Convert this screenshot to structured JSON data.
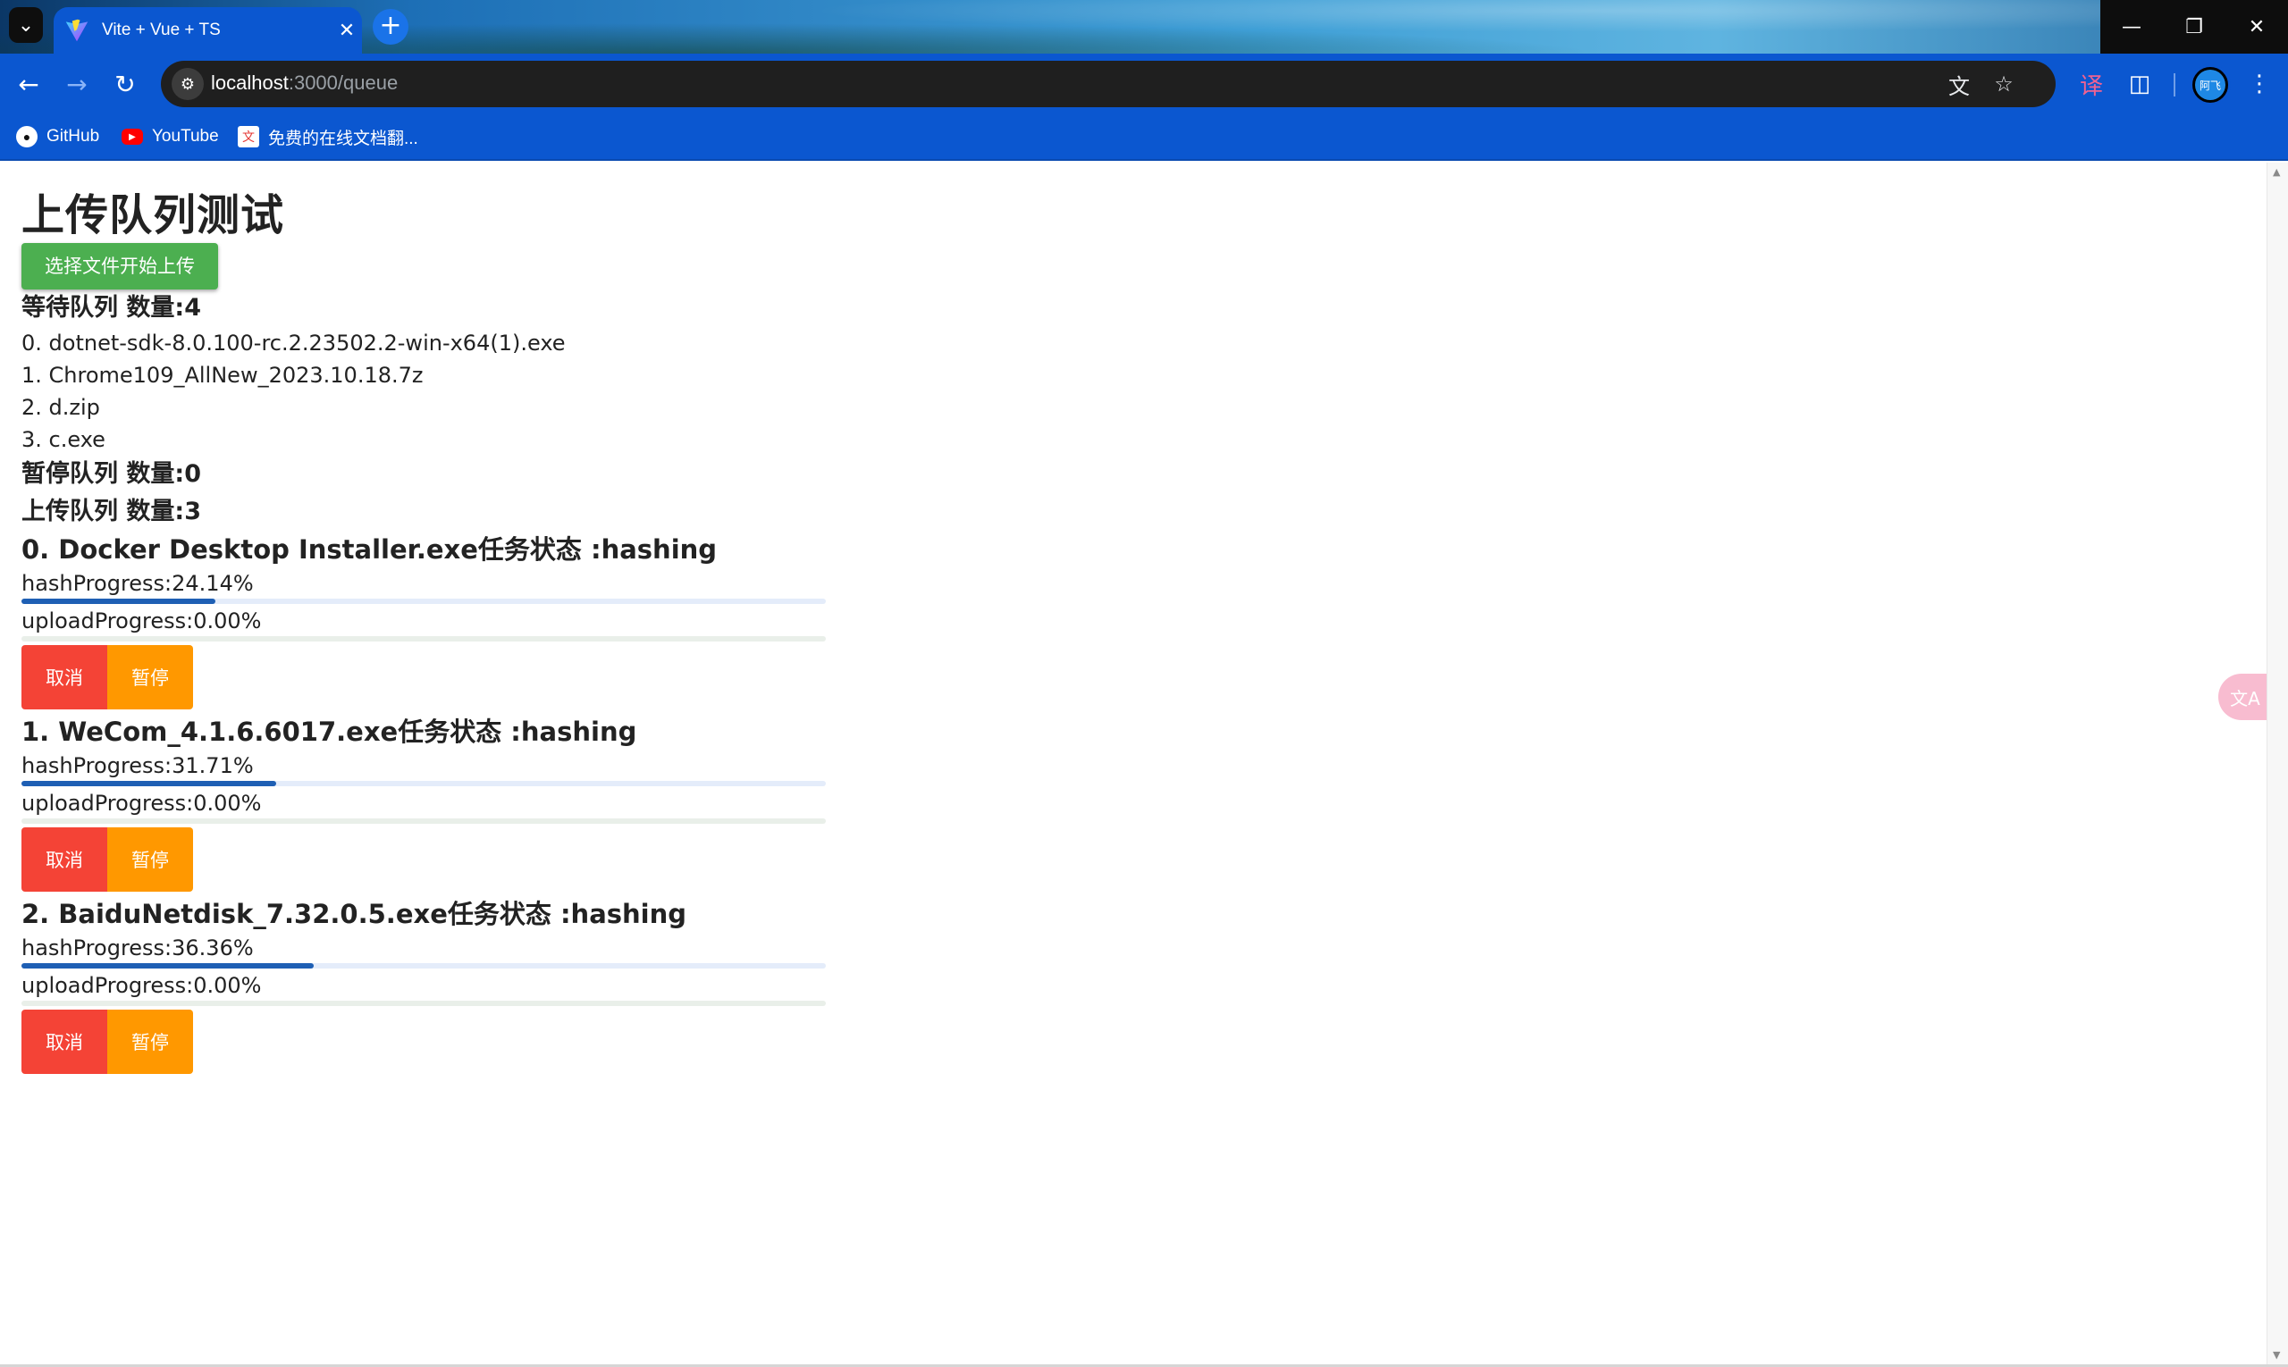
{
  "browser": {
    "tab_title": "Vite + Vue + TS",
    "url_host": "localhost",
    "url_path": ":3000/queue",
    "bookmarks": [
      {
        "label": "GitHub",
        "icon": "github-icon"
      },
      {
        "label": "YouTube",
        "icon": "youtube-icon"
      },
      {
        "label": "免费的在线文档翻...",
        "icon": "translate-doc-icon"
      }
    ],
    "avatar_text": "阿飞"
  },
  "page": {
    "title": "上传队列测试",
    "upload_button": "选择文件开始上传",
    "waiting": {
      "heading": "等待队列 数量:4",
      "items": [
        "0. dotnet-sdk-8.0.100-rc.2.23502.2-win-x64(1).exe",
        "1. Chrome109_AllNew_2023.10.18.7z",
        "2. d.zip",
        "3. c.exe"
      ]
    },
    "paused": {
      "heading": "暂停队列 数量:0"
    },
    "uploading": {
      "heading": "上传队列 数量:3",
      "tasks": [
        {
          "title": "0. Docker Desktop Installer.exe任务状态 :hashing",
          "hash_label": "hashProgress:24.14%",
          "hash_progress": 24.14,
          "upload_label": "uploadProgress:0.00%",
          "upload_progress": 0.0,
          "cancel": "取消",
          "pause": "暂停"
        },
        {
          "title": "1. WeCom_4.1.6.6017.exe任务状态 :hashing",
          "hash_label": "hashProgress:31.71%",
          "hash_progress": 31.71,
          "upload_label": "uploadProgress:0.00%",
          "upload_progress": 0.0,
          "cancel": "取消",
          "pause": "暂停"
        },
        {
          "title": "2. BaiduNetdisk_7.32.0.5.exe任务状态 :hashing",
          "hash_label": "hashProgress:36.36%",
          "hash_progress": 36.36,
          "upload_label": "uploadProgress:0.00%",
          "upload_progress": 0.0,
          "cancel": "取消",
          "pause": "暂停"
        }
      ]
    }
  },
  "colors": {
    "upload_button": "#4caf50",
    "cancel_button": "#f44336",
    "pause_button": "#ff9800",
    "progress_fill": "#1e5fb4"
  }
}
